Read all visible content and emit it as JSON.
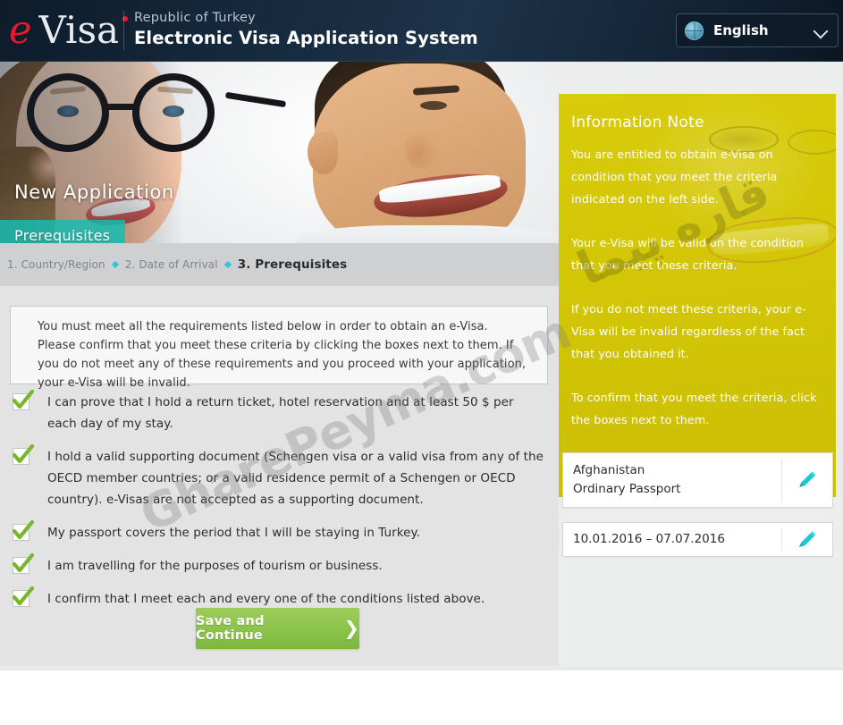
{
  "header": {
    "logo": {
      "e": "e",
      "visa": "Visa"
    },
    "subtitle": "Republic of Turkey",
    "title": "Electronic Visa Application System",
    "language": {
      "label": "English",
      "icon": "globe-icon",
      "chevron": "chevron-down-icon"
    }
  },
  "hero": {
    "title": "New Application",
    "tab": "Prerequisites"
  },
  "breadcrumb": {
    "steps": [
      {
        "label": "1. Country/Region",
        "active": false
      },
      {
        "label": "2. Date of Arrival",
        "active": false
      },
      {
        "label": "3. Prerequisites",
        "active": true
      }
    ]
  },
  "notice": {
    "text": "You must meet all the requirements listed below in order to obtain an e-Visa. Please confirm that you meet these criteria by clicking the boxes next to them. If you do not meet any of these requirements and you proceed with your application, your e-Visa will be invalid."
  },
  "checklist": {
    "items": [
      {
        "checked": true,
        "text": "I can prove that I hold a return ticket, hotel reservation and at least 50 $ per each day of my stay."
      },
      {
        "checked": true,
        "text": "I hold a valid supporting document (Schengen visa or a valid visa from any of the OECD member countries; or a valid residence permit of a Schengen or OECD country). e-Visas are not accepted as a supporting document."
      },
      {
        "checked": true,
        "text": "My passport covers the period that I will be staying in Turkey."
      },
      {
        "checked": true,
        "text": "I am travelling for the purposes of tourism or business."
      },
      {
        "checked": true,
        "text": "I confirm that I meet each and every one of the conditions listed above."
      }
    ]
  },
  "actions": {
    "save_label": "Save and Continue",
    "save_arrow": "❯"
  },
  "info_note": {
    "title": "Information Note",
    "paragraphs": [
      "You are entitled to obtain e-Visa on condition that you meet the criteria indicated on the left side.",
      "Your e-Visa will be valid on the condition that you meet these criteria.",
      "If you do not meet these criteria, your e-Visa will be invalid regardless of the fact that you obtained it.",
      "To confirm that you meet the criteria, click the boxes next to them."
    ]
  },
  "summary": {
    "country_card": {
      "country": "Afghanistan",
      "passport": "Ordinary Passport",
      "edit_icon": "pencil-icon"
    },
    "date_card": {
      "range": "10.01.2016 – 07.07.2016",
      "edit_icon": "pencil-icon"
    }
  },
  "watermark": {
    "latin": "GharePeyma.com",
    "persian": "قاره پیما"
  },
  "colors": {
    "header_dark": "#0d1b2a",
    "teal": "#11beb4",
    "yellow": "#d4c707",
    "green": "#8bc34a",
    "breadcrumb_bg": "#cfd0d2",
    "body_bg": "#e3e3e3"
  }
}
